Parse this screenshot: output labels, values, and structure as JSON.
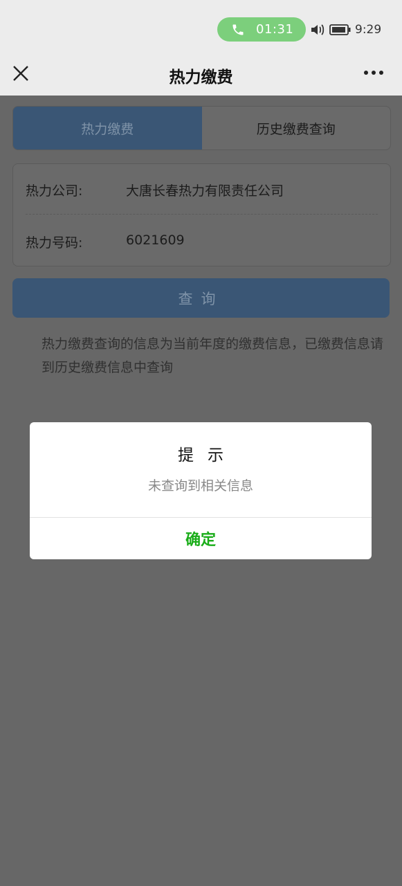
{
  "status_bar": {
    "call_timer": "01:31",
    "clock": "9:29",
    "icons": [
      "phone-icon",
      "volume-icon",
      "battery-icon"
    ]
  },
  "title_bar": {
    "title": "热力缴费",
    "left_icon": "close-icon",
    "right_icon": "more-icon"
  },
  "tabs": [
    {
      "label": "热力缴费",
      "active": true
    },
    {
      "label": "历史缴费查询",
      "active": false
    }
  ],
  "info": {
    "company_label": "热力公司:",
    "company_value": "大唐长春热力有限责任公司",
    "number_label": "热力号码:",
    "number_value": "6021609"
  },
  "query_button": "查询",
  "notice": "热力缴费查询的信息为当前年度的缴费信息，已缴费信息请到历史缴费信息中查询",
  "dialog": {
    "title": "提示",
    "message": "未查询到相关信息",
    "confirm": "确定"
  },
  "colors": {
    "overlay": "#676767",
    "primary_dimmed": "#3a5675",
    "confirm_green": "#1aad19",
    "call_pill": "#7ccf7c"
  }
}
